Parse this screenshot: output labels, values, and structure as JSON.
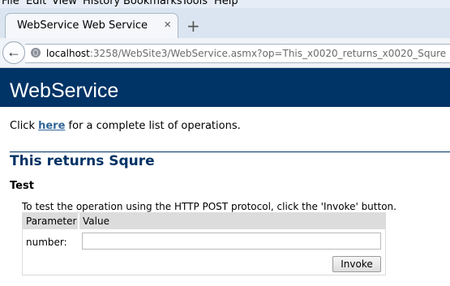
{
  "menu": {
    "items": [
      "File",
      "Edit",
      "View",
      "History",
      "Bookmarks",
      "Tools",
      "Help"
    ]
  },
  "tab": {
    "title": "WebService Web Service",
    "close_glyph": "×",
    "new_tab_glyph": "+"
  },
  "nav": {
    "back_glyph": "←",
    "url_host": "localhost",
    "url_rest": ":3258/WebSite3/WebService.asmx?op=This_x0020_returns_x0020_Squre"
  },
  "page": {
    "header_title": "WebService",
    "intro_before": "Click ",
    "intro_link": "here",
    "intro_after": " for a complete list of operations.",
    "operation_title": "This returns Squre",
    "test_heading": "Test",
    "test_description": "To test the operation using the HTTP POST protocol, click the 'Invoke' button."
  },
  "params": {
    "col_parameter": "Parameter",
    "col_value": "Value",
    "rows": [
      {
        "label": "number:",
        "value": ""
      }
    ]
  },
  "invoke_label": "Invoke"
}
